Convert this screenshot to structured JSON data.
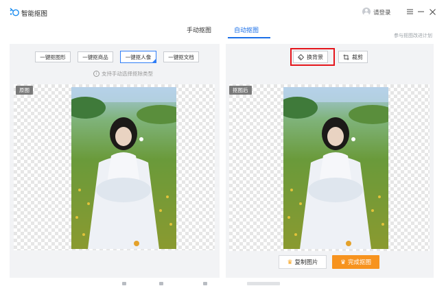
{
  "app": {
    "title": "智能抠图",
    "login_label": "请登录"
  },
  "tabs": [
    {
      "label": "手动抠图",
      "active": false
    },
    {
      "label": "自动抠图",
      "active": true
    }
  ],
  "plan_link": "参与抠图改进计划",
  "left_panel": {
    "mode_buttons": [
      {
        "label": "一键抠图形",
        "selected": false
      },
      {
        "label": "一键抠商品",
        "selected": false
      },
      {
        "label": "一键抠人像",
        "selected": true
      },
      {
        "label": "一键抠文档",
        "selected": false
      }
    ],
    "hint": "支持手动选择抠除类型",
    "image_label": "原图"
  },
  "right_panel": {
    "tools": [
      {
        "label": "换背景",
        "icon": "change-background-icon"
      },
      {
        "label": "裁剪",
        "icon": "crop-icon"
      }
    ],
    "image_label": "抠图后",
    "copy_label": "复制图片",
    "finish_label": "完成抠图"
  },
  "colors": {
    "accent": "#1a6fe8",
    "finish": "#f7931e",
    "highlight": "#e4141a",
    "tag": "#7a7a7a"
  }
}
